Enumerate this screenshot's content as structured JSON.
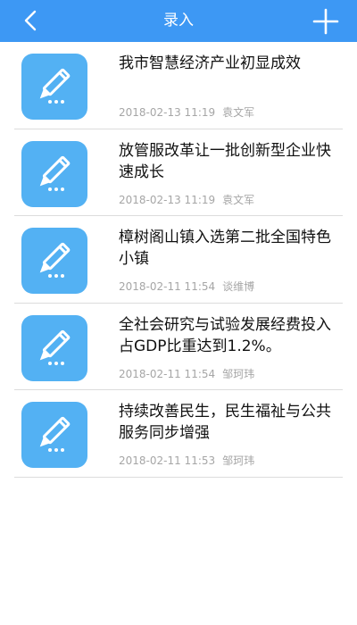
{
  "nav": {
    "title": "录入",
    "back_icon": "chevron-left-icon",
    "add_icon": "plus-icon"
  },
  "colors": {
    "nav_bg": "#3d98f4",
    "thumb_bg": "#53b1f3"
  },
  "items": [
    {
      "title": "我市智慧经济产业初显成效",
      "date": "2018-02-13 11:19",
      "author": "袁文军",
      "icon": "edit-pencil-icon"
    },
    {
      "title": "放管服改革让一批创新型企业快速成长",
      "date": "2018-02-13 11:19",
      "author": "袁文军",
      "icon": "edit-pencil-icon"
    },
    {
      "title": "樟树阁山镇入选第二批全国特色小镇",
      "date": "2018-02-11 11:54",
      "author": "谈维博",
      "icon": "edit-pencil-icon"
    },
    {
      "title": "全社会研究与试验发展经费投入占GDP比重达到1.2%。",
      "date": "2018-02-11 11:54",
      "author": "邹珂玮",
      "icon": "edit-pencil-icon"
    },
    {
      "title": "持续改善民生，民生福祉与公共服务同步增强",
      "date": "2018-02-11 11:53",
      "author": "邹珂玮",
      "icon": "edit-pencil-icon"
    }
  ]
}
